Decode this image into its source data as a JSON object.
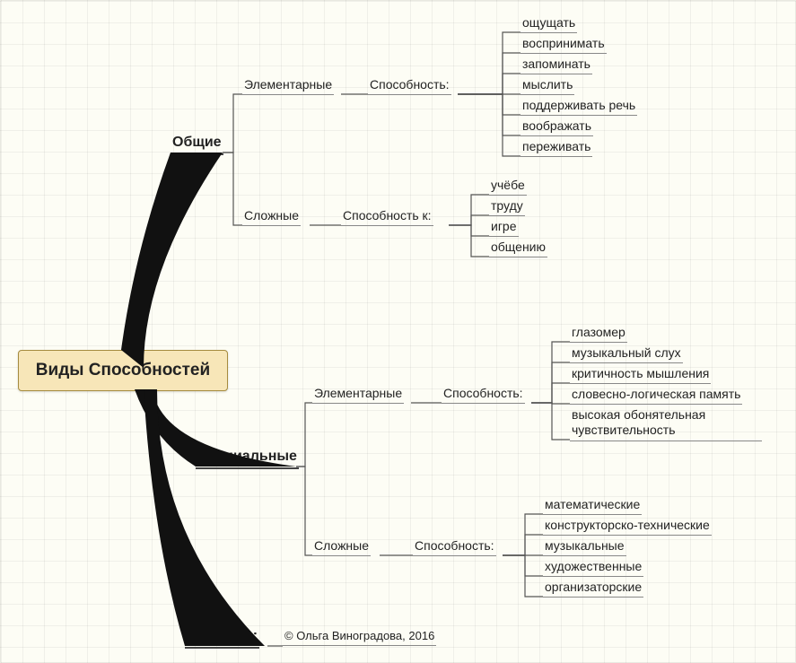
{
  "root": "Виды Способностей",
  "branches": {
    "b1": {
      "label": "Общие",
      "children": {
        "c1": {
          "label": "Элементарные",
          "via": "Способность:",
          "items": [
            "ощущать",
            "воспринимать",
            "запоминать",
            "мыслить",
            "поддерживать речь",
            "воображать",
            "переживать"
          ]
        },
        "c2": {
          "label": "Сложные",
          "via": "Способность к:",
          "items": [
            "учёбе",
            "труду",
            "игре",
            "общению"
          ]
        }
      }
    },
    "b2": {
      "label": "Специальные",
      "children": {
        "c1": {
          "label": "Элементарные",
          "via": "Способность:",
          "items": [
            "глазомер",
            "музыкальный слух",
            "критичность мышления",
            "словесно-логическая память",
            "высокая обонятельная чувствительность"
          ]
        },
        "c2": {
          "label": "Сложные",
          "via": "Способность:",
          "items": [
            "математические",
            "конструкторско-технические",
            "музыкальные",
            "художественные",
            "организаторские"
          ]
        }
      }
    },
    "b3": {
      "label": "Mind Map:",
      "credit": "© Ольга Виноградова, 2016"
    }
  }
}
